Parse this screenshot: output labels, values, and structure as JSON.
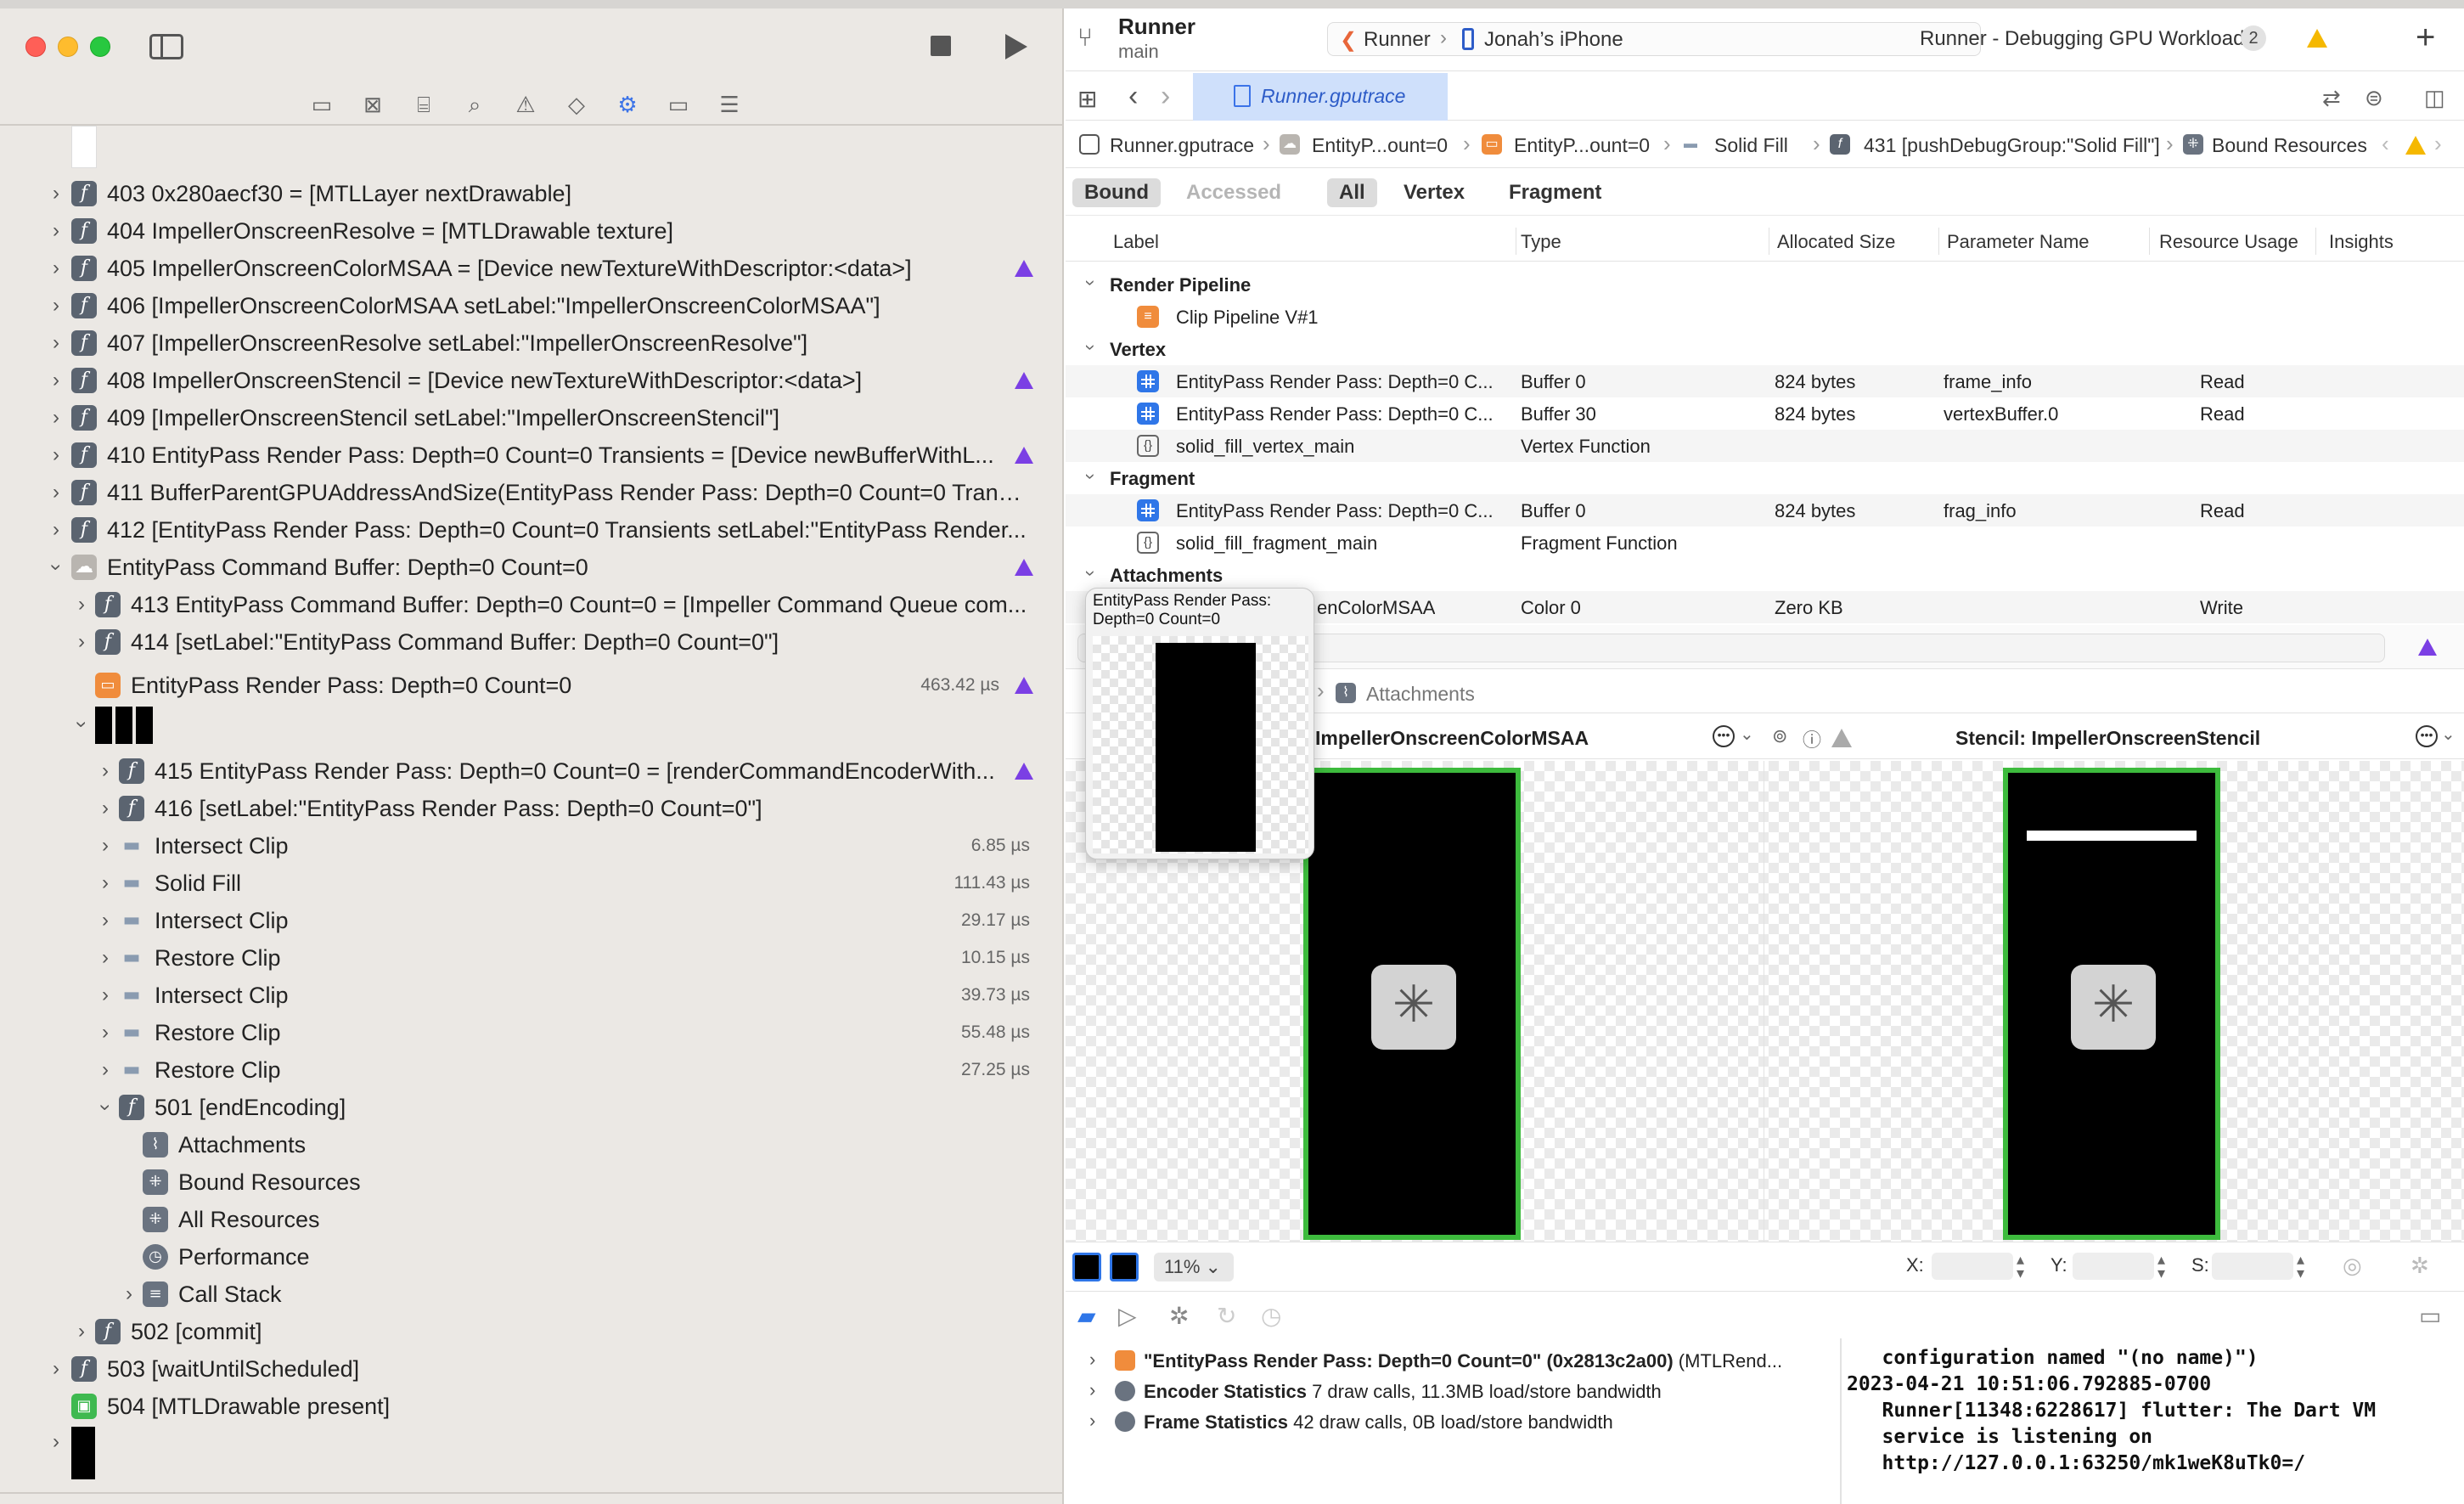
{
  "app": {
    "project": "Runner",
    "branch": "main",
    "scheme": "Runner",
    "device": "Jonah’s iPhone",
    "status": "Runner - Debugging GPU Workload",
    "status_count": "2"
  },
  "editor": {
    "file_tab": "Runner.gputrace",
    "breadcrumbs": [
      "Runner.gputrace",
      "EntityP...ount=0",
      "EntityP...ount=0",
      "Solid Fill",
      "431 [pushDebugGroup:\"Solid Fill\"]",
      "Bound Resources"
    ],
    "filters": [
      "Bound",
      "Accessed",
      "All",
      "Vertex",
      "Fragment"
    ],
    "columns": [
      "Label",
      "Type",
      "Allocated Size",
      "Parameter Name",
      "Resource Usage",
      "Insights"
    ],
    "groups": {
      "render_pipeline": "Render Pipeline",
      "vertex": "Vertex",
      "fragment": "Fragment",
      "attachments": "Attachments"
    },
    "rows": {
      "pipeline": {
        "label": "Clip Pipeline V#1"
      },
      "v1": {
        "label": "EntityPass Render Pass: Depth=0 C...",
        "type": "Buffer 0",
        "size": "824 bytes",
        "param": "frame_info",
        "usage": "Read"
      },
      "v2": {
        "label": "EntityPass Render Pass: Depth=0 C...",
        "type": "Buffer 30",
        "size": "824 bytes",
        "param": "vertexBuffer.0",
        "usage": "Read"
      },
      "v3": {
        "label": "solid_fill_vertex_main",
        "type": "Vertex Function"
      },
      "f1": {
        "label": "EntityPass Render Pass: Depth=0 C...",
        "type": "Buffer 0",
        "size": "824 bytes",
        "param": "frag_info",
        "usage": "Read"
      },
      "f2": {
        "label": "solid_fill_fragment_main",
        "type": "Fragment Function"
      },
      "a1": {
        "label": "enColorMSAA",
        "type": "Color 0",
        "size": "Zero KB",
        "usage": "Write"
      }
    },
    "attachments_crumb": "Attachments",
    "color_attachment_title": "ImpellerOnscreenColorMSAA",
    "stencil_attachment_title": "Stencil: ImpellerOnscreenStencil",
    "zoom": "11%",
    "coords": {
      "x_label": "X:",
      "y_label": "Y:",
      "s_label": "S:"
    }
  },
  "popover": {
    "title": "EntityPass Render Pass: Depth=0 Count=0"
  },
  "navigator": {
    "rows": [
      {
        "id": "403",
        "text": "403 0x280aecf30 = [MTLLayer nextDrawable]"
      },
      {
        "id": "404",
        "text": "404 ImpellerOnscreenResolve = [MTLDrawable texture]"
      },
      {
        "id": "405",
        "text": "405 ImpellerOnscreenColorMSAA = [Device newTextureWithDescriptor:<data>]"
      },
      {
        "id": "406",
        "text": "406 [ImpellerOnscreenColorMSAA setLabel:\"ImpellerOnscreenColorMSAA\"]"
      },
      {
        "id": "407",
        "text": "407 [ImpellerOnscreenResolve setLabel:\"ImpellerOnscreenResolve\"]"
      },
      {
        "id": "408",
        "text": "408 ImpellerOnscreenStencil = [Device newTextureWithDescriptor:<data>]"
      },
      {
        "id": "409",
        "text": "409 [ImpellerOnscreenStencil setLabel:\"ImpellerOnscreenStencil\"]"
      },
      {
        "id": "410",
        "text": "410 EntityPass Render Pass: Depth=0 Count=0 Transients = [Device newBufferWithL..."
      },
      {
        "id": "411",
        "text": "411 BufferParentGPUAddressAndSize(EntityPass Render Pass: Depth=0 Count=0 Transi..."
      },
      {
        "id": "412",
        "text": "412 [EntityPass Render Pass: Depth=0 Count=0 Transients setLabel:\"EntityPass Render..."
      },
      {
        "id": "cmdbuf",
        "text": "EntityPass Command Buffer: Depth=0 Count=0"
      },
      {
        "id": "413",
        "text": "413 EntityPass Command Buffer: Depth=0 Count=0 = [Impeller Command Queue com..."
      },
      {
        "id": "414",
        "text": "414 [setLabel:\"EntityPass Command Buffer: Depth=0 Count=0\"]"
      },
      {
        "id": "pass",
        "text": "EntityPass Render Pass: Depth=0 Count=0",
        "time": "463.42 µs"
      },
      {
        "id": "415",
        "text": "415 EntityPass Render Pass: Depth=0 Count=0 = [renderCommandEncoderWith..."
      },
      {
        "id": "416",
        "text": "416 [setLabel:\"EntityPass Render Pass: Depth=0 Count=0\"]"
      },
      {
        "id": "g1",
        "text": "Intersect Clip",
        "time": "6.85 µs"
      },
      {
        "id": "g2",
        "text": "Solid Fill",
        "time": "111.43 µs"
      },
      {
        "id": "g3",
        "text": "Intersect Clip",
        "time": "29.17 µs"
      },
      {
        "id": "g4",
        "text": "Restore Clip",
        "time": "10.15 µs"
      },
      {
        "id": "g5",
        "text": "Intersect Clip",
        "time": "39.73 µs"
      },
      {
        "id": "g6",
        "text": "Restore Clip",
        "time": "55.48 µs"
      },
      {
        "id": "g7",
        "text": "Restore Clip",
        "time": "27.25 µs"
      },
      {
        "id": "501",
        "text": "501 [endEncoding]"
      },
      {
        "id": "s1",
        "text": "Attachments"
      },
      {
        "id": "s2",
        "text": "Bound Resources"
      },
      {
        "id": "s3",
        "text": "All Resources"
      },
      {
        "id": "s4",
        "text": "Performance"
      },
      {
        "id": "s5",
        "text": "Call Stack"
      },
      {
        "id": "502",
        "text": "502 [commit]"
      },
      {
        "id": "503",
        "text": "503 [waitUntilScheduled]"
      },
      {
        "id": "504",
        "text": "504 [MTLDrawable present]"
      }
    ]
  },
  "bottom": {
    "rows": [
      {
        "title": "\"EntityPass Render Pass: Depth=0 Count=0\" (0x2813c2a00)",
        "detail": " (MTLRend..."
      },
      {
        "title": "Encoder Statistics",
        "detail": " 7 draw calls, 11.3MB load/store bandwidth"
      },
      {
        "title": "Frame Statistics",
        "detail": " 42 draw calls, 0B load/store bandwidth"
      }
    ],
    "console": "   configuration named \"(no name)\")\n2023-04-21 10:51:06.792885-0700\n   Runner[11348:6228617] flutter: The Dart VM\n   service is listening on\n   http://127.0.0.1:63250/mk1weK8uTk0=/"
  }
}
